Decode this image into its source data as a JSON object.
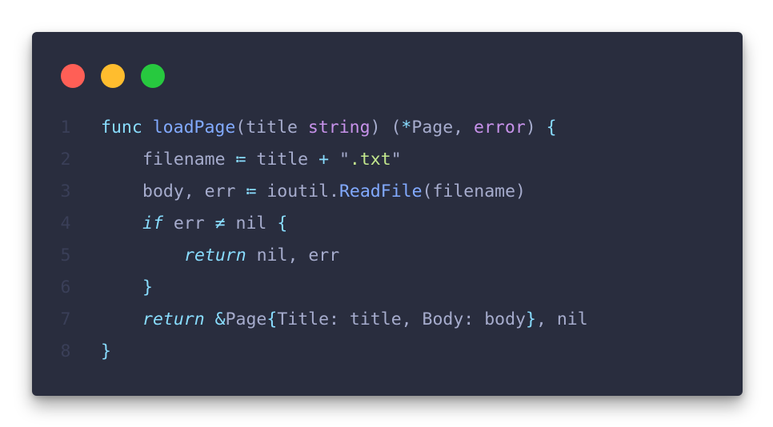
{
  "window": {
    "controls": [
      {
        "name": "close",
        "color": "#ff5f56"
      },
      {
        "name": "minimize",
        "color": "#ffbd2e"
      },
      {
        "name": "maximize",
        "color": "#27c93f"
      }
    ]
  },
  "colors": {
    "background": "#292d3e",
    "text": "#a6accd",
    "keyword": "#89ddff",
    "function": "#82aaff",
    "type": "#c792ea",
    "string": "#c3e88d",
    "line_number": "#3a3f58"
  },
  "lines": [
    {
      "number": "1",
      "indent": 0,
      "tokens": [
        {
          "t": "func",
          "c": "kw"
        },
        {
          "t": " ",
          "c": "tx"
        },
        {
          "t": "loadPage",
          "c": "fn"
        },
        {
          "t": "(title ",
          "c": "tx"
        },
        {
          "t": "string",
          "c": "ty"
        },
        {
          "t": ") (",
          "c": "tx"
        },
        {
          "t": "*",
          "c": "op"
        },
        {
          "t": "Page, ",
          "c": "tx"
        },
        {
          "t": "error",
          "c": "ty"
        },
        {
          "t": ") ",
          "c": "tx"
        },
        {
          "t": "{",
          "c": "kw"
        }
      ]
    },
    {
      "number": "2",
      "indent": 1,
      "tokens": [
        {
          "t": "filename ",
          "c": "tx"
        },
        {
          "t": "≔",
          "c": "op"
        },
        {
          "t": " title ",
          "c": "tx"
        },
        {
          "t": "+",
          "c": "op"
        },
        {
          "t": " \"",
          "c": "tx"
        },
        {
          "t": ".txt",
          "c": "str"
        },
        {
          "t": "\"",
          "c": "tx"
        }
      ]
    },
    {
      "number": "3",
      "indent": 1,
      "tokens": [
        {
          "t": "body, err ",
          "c": "tx"
        },
        {
          "t": "≔",
          "c": "op"
        },
        {
          "t": " ioutil.",
          "c": "tx"
        },
        {
          "t": "ReadFile",
          "c": "fn"
        },
        {
          "t": "(filename)",
          "c": "tx"
        }
      ]
    },
    {
      "number": "4",
      "indent": 1,
      "tokens": [
        {
          "t": "if",
          "c": "it"
        },
        {
          "t": " err ",
          "c": "tx"
        },
        {
          "t": "≠",
          "c": "op"
        },
        {
          "t": " nil ",
          "c": "tx"
        },
        {
          "t": "{",
          "c": "kw"
        }
      ]
    },
    {
      "number": "5",
      "indent": 2,
      "tokens": [
        {
          "t": "return",
          "c": "it"
        },
        {
          "t": " nil, err",
          "c": "tx"
        }
      ]
    },
    {
      "number": "6",
      "indent": 1,
      "tokens": [
        {
          "t": "}",
          "c": "kw"
        }
      ]
    },
    {
      "number": "7",
      "indent": 1,
      "tokens": [
        {
          "t": "return",
          "c": "it"
        },
        {
          "t": " ",
          "c": "tx"
        },
        {
          "t": "&",
          "c": "op"
        },
        {
          "t": "Page",
          "c": "tx"
        },
        {
          "t": "{",
          "c": "kw"
        },
        {
          "t": "Title: title, Body: body",
          "c": "tx"
        },
        {
          "t": "}",
          "c": "kw"
        },
        {
          "t": ", nil",
          "c": "tx"
        }
      ]
    },
    {
      "number": "8",
      "indent": 0,
      "tokens": [
        {
          "t": "}",
          "c": "kw"
        }
      ]
    }
  ]
}
